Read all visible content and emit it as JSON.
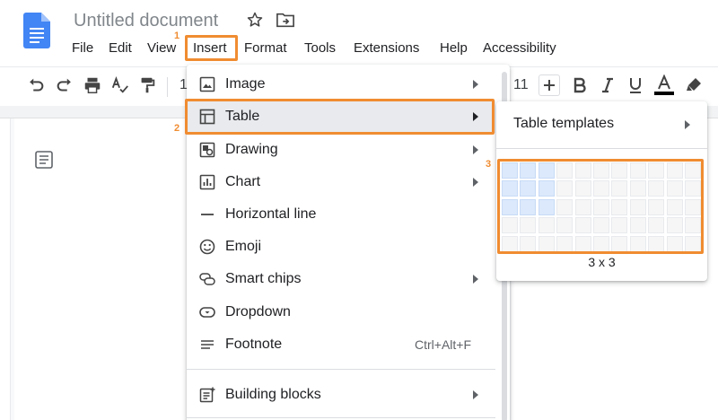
{
  "doc": {
    "title": "Untitled document"
  },
  "menubar": [
    "File",
    "Edit",
    "View",
    "Insert",
    "Format",
    "Tools",
    "Extensions",
    "Help",
    "Accessibility"
  ],
  "annotations": {
    "step1": "1",
    "step2": "2",
    "step3": "3"
  },
  "toolbar": {
    "zoom_fragment": "1",
    "font_size_fragment": "11"
  },
  "insert_menu": {
    "items": [
      {
        "label": "Image",
        "icon": "image-icon",
        "submenu": true
      },
      {
        "label": "Table",
        "icon": "table-icon",
        "submenu": true
      },
      {
        "label": "Drawing",
        "icon": "drawing-icon",
        "submenu": true
      },
      {
        "label": "Chart",
        "icon": "chart-icon",
        "submenu": true
      },
      {
        "label": "Horizontal line",
        "icon": "horizontal-line-icon",
        "submenu": false
      },
      {
        "label": "Emoji",
        "icon": "emoji-icon",
        "submenu": false
      },
      {
        "label": "Smart chips",
        "icon": "smart-chips-icon",
        "submenu": true
      },
      {
        "label": "Dropdown",
        "icon": "dropdown-icon",
        "submenu": false
      },
      {
        "label": "Footnote",
        "icon": "footnote-icon",
        "submenu": false,
        "shortcut": "Ctrl+Alt+F"
      },
      {
        "label": "Building blocks",
        "icon": "building-blocks-icon",
        "submenu": true
      }
    ]
  },
  "table_submenu": {
    "templates_label": "Table templates",
    "grid_size_label": "3 x 3",
    "grid_columns": 11,
    "grid_rows": 5,
    "selected_columns": 3,
    "selected_rows": 3
  },
  "colors": {
    "highlight": "#f08c31",
    "selected_cell": "#dce9fc",
    "docs_blue": "#4285f4"
  }
}
